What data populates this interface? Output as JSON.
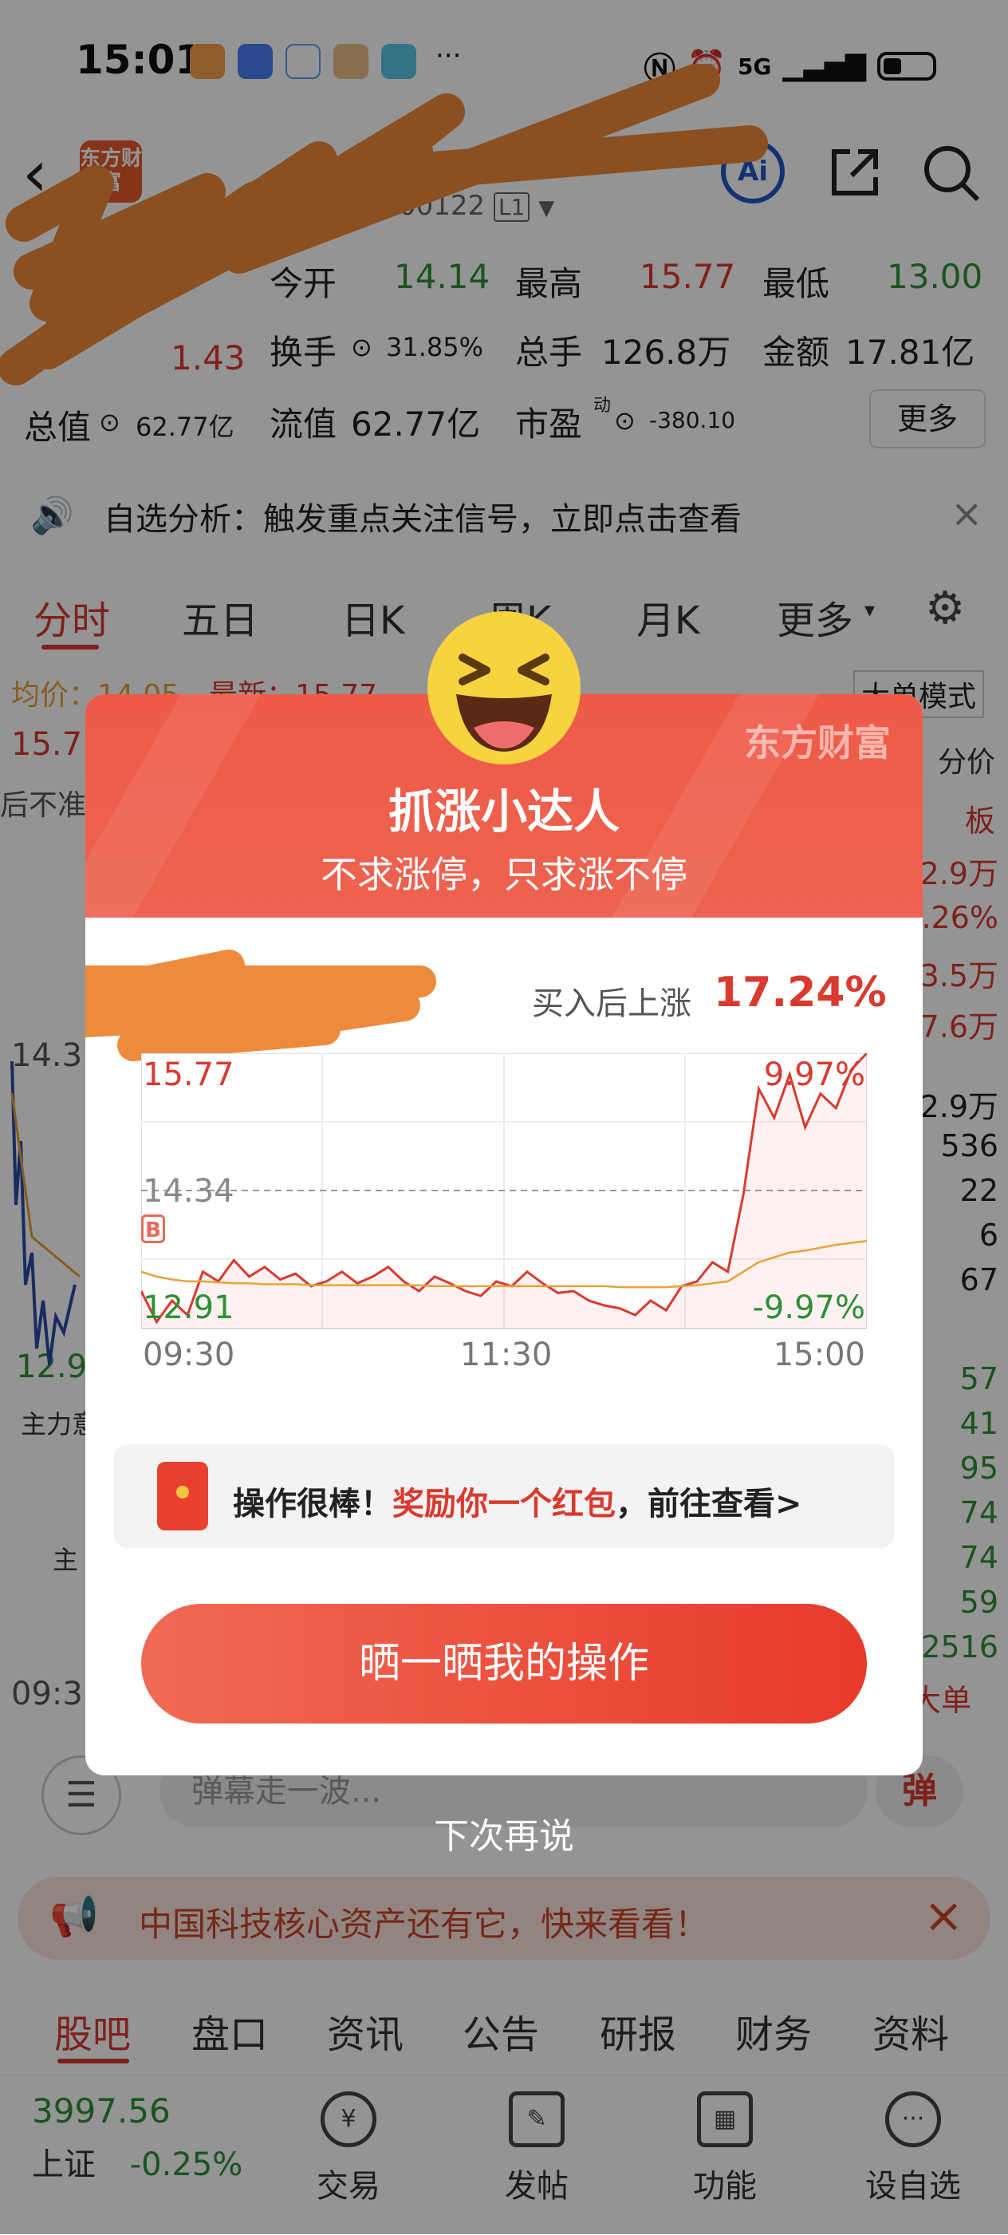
{
  "status_bar": {
    "time": "15:01",
    "network": "5G",
    "icons": [
      "health-app-icon",
      "honor-app-icon",
      "chat-app-icon",
      "game-app-icon",
      "book-app-icon",
      "more-icon",
      "nfc-icon",
      "alarm-icon",
      "signal-icon",
      "battery-icon"
    ]
  },
  "header": {
    "logo_text": "东方财富",
    "code_suffix": "00122",
    "level_badge": "L1",
    "ai_label": "Ai"
  },
  "quote": {
    "open_label": "今开",
    "open_value": "14.14",
    "high_label": "最高",
    "high_value": "15.77",
    "low_label": "最低",
    "low_value": "13.00",
    "change_value": "1.43",
    "turnover_label": "换手",
    "turnover_value": "31.85%",
    "volume_label": "总手",
    "volume_value": "126.8万",
    "amount_label": "金额",
    "amount_value": "17.81亿",
    "total_cap_label": "总值",
    "total_cap_value": "62.77亿",
    "float_cap_label": "流值",
    "float_cap_value": "62.77亿",
    "pe_label": "市盈",
    "pe_sup": "动",
    "pe_value": "-380.10",
    "more_label": "更多"
  },
  "notice": {
    "text": "自选分析：触发重点关注信号，立即点击查看"
  },
  "chart_tabs": [
    "分时",
    "五日",
    "日K",
    "周K",
    "月K",
    "更多"
  ],
  "bg_chart": {
    "avg_label": "均价：14.05",
    "latest_label": "最新：15.77",
    "big_order_label": "大单模式",
    "left_price": "15.7",
    "left_note": "后不准",
    "mid_price": "14.3",
    "low_price": "12.9",
    "main_label": "主力意",
    "main_label2": "主",
    "time_label": "09:3",
    "right_label": "分价",
    "right_label2": "板",
    "right_values": [
      "2.9万",
      ".26%",
      "3.5万",
      "7.6万",
      "2.9万",
      "536",
      "22",
      "6",
      "67",
      "57",
      "41",
      "95",
      "74",
      "74",
      "59",
      "2516"
    ],
    "right_foot": "大单"
  },
  "danmu": {
    "placeholder": "弹幕走一波..."
  },
  "promo": {
    "text": "中国科技核心资产还有它，快来看看！"
  },
  "bottom_tabs": [
    "股吧",
    "盘口",
    "资讯",
    "公告",
    "研报",
    "财务",
    "资料"
  ],
  "bottom_nav": {
    "index_value": "3997.56",
    "index_name": "上证",
    "index_change": "-0.25%",
    "items": [
      "交易",
      "发帖",
      "功能",
      "设自选"
    ]
  },
  "modal": {
    "brand": "东方财富",
    "title": "抓涨小达人",
    "subtitle": "不求涨停，只求涨不停",
    "gain_label": "买入后上涨",
    "gain_value": "17.24%",
    "reward_prefix": "操作很棒！",
    "reward_highlight": "奖励你一个红包",
    "reward_suffix": "，前往查看>",
    "share_label": "晒一晒我的操作",
    "later_label": "下次再说"
  },
  "chart_data": {
    "type": "line",
    "y_max_label": "15.77",
    "y_mid_label": "14.34",
    "y_min_label": "12.91",
    "pct_max_label": "9.97%",
    "pct_min_label": "-9.97%",
    "x_tick_labels": [
      "09:30",
      "11:30",
      "15:00"
    ],
    "ylim": [
      12.91,
      15.77
    ],
    "buy_marker": "B",
    "series": [
      {
        "values": [
          13.3,
          12.98,
          13.2,
          13.05,
          13.5,
          13.4,
          13.62,
          13.45,
          13.55,
          13.42,
          13.48,
          13.35,
          13.4,
          13.5,
          13.38,
          13.45,
          13.55,
          13.4,
          13.3,
          13.45,
          13.38,
          13.3,
          13.25,
          13.4,
          13.35,
          13.5,
          13.38,
          13.28,
          13.3,
          13.2,
          13.15,
          13.12,
          13.05,
          13.2,
          13.1,
          13.35,
          13.4,
          13.6,
          13.5,
          14.3,
          15.4,
          15.1,
          15.55,
          15.0,
          15.35,
          15.2,
          15.6,
          15.77
        ],
        "color": "#d93a2f"
      },
      {
        "values": [
          13.5,
          13.45,
          13.42,
          13.4,
          13.4,
          13.39,
          13.38,
          13.38,
          13.37,
          13.37,
          13.37,
          13.36,
          13.36,
          13.36,
          13.36,
          13.36,
          13.36,
          13.36,
          13.36,
          13.35,
          13.35,
          13.35,
          13.35,
          13.35,
          13.35,
          13.35,
          13.35,
          13.35,
          13.35,
          13.35,
          13.35,
          13.34,
          13.34,
          13.34,
          13.34,
          13.35,
          13.36,
          13.38,
          13.4,
          13.5,
          13.6,
          13.65,
          13.7,
          13.72,
          13.75,
          13.78,
          13.8,
          13.82
        ],
        "color": "#e6a33a"
      }
    ]
  }
}
